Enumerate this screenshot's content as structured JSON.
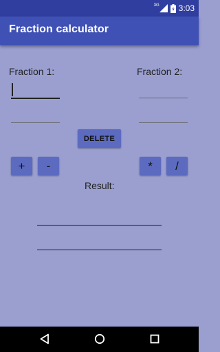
{
  "status_bar": {
    "time": "3:03",
    "network_label": "3G"
  },
  "app_bar": {
    "title": "Fraction calculator"
  },
  "fraction1": {
    "label": "Fraction 1:",
    "numerator": "",
    "denominator": ""
  },
  "fraction2": {
    "label": "Fraction 2:",
    "numerator": "",
    "denominator": ""
  },
  "buttons": {
    "delete": "DELETE",
    "add": "+",
    "subtract": "-",
    "multiply": "*",
    "divide": "/"
  },
  "result": {
    "label": "Result:",
    "numerator": "",
    "denominator": ""
  },
  "colors": {
    "background": "#9a9fd0",
    "app_bar": "#3f51b5",
    "status_bar": "#303f9f",
    "button": "#5c6bc0"
  },
  "icons": {
    "status": [
      "signal-icon",
      "battery-icon"
    ],
    "nav": [
      "back-icon",
      "home-icon",
      "recents-icon"
    ]
  }
}
